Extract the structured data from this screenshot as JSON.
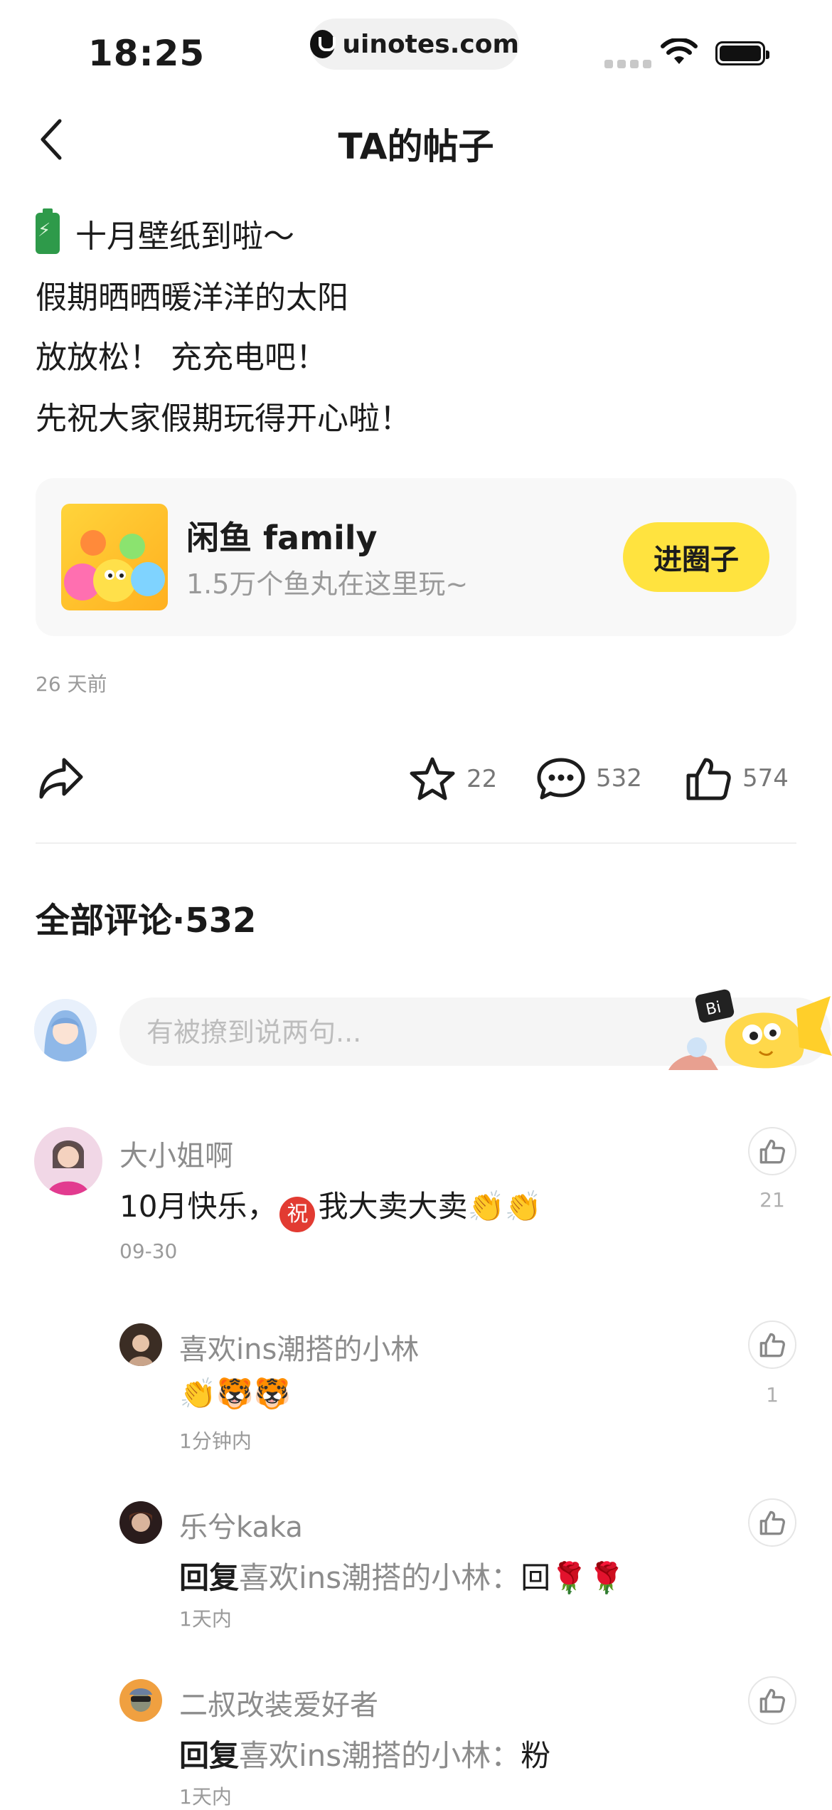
{
  "status_bar": {
    "time": "18:25",
    "url": "uinotes.com"
  },
  "header": {
    "title": "TA的帖子"
  },
  "post": {
    "lines": [
      "十月壁纸到啦～",
      "假期晒晒暖洋洋的太阳",
      "放放松！ 充充电吧！",
      "先祝大家假期玩得开心啦！"
    ],
    "circle": {
      "name": "闲鱼 family",
      "desc": "1.5万个鱼丸在这里玩~",
      "join_label": "进圈子"
    },
    "time": "26 天前",
    "stats": {
      "favorites": "22",
      "comments": "532",
      "likes": "574"
    }
  },
  "comments_section": {
    "title": "全部评论·532",
    "input_placeholder": "有被撩到说两句..."
  },
  "comments": [
    {
      "user": "大小姐啊",
      "text_before": "10月快乐，",
      "badge": "祝",
      "text_after": "我大卖大卖👏👏",
      "date": "09-30",
      "likes": "21"
    },
    {
      "user": "喜欢ins潮搭的小林",
      "text": "👏🐯🐯",
      "date": "1分钟内",
      "likes": "1"
    },
    {
      "user": "乐兮kaka",
      "reply_kw": "回复",
      "reply_to": "喜欢ins潮搭的小林：",
      "text": "回🌹🌹",
      "date": "1天内",
      "likes": ""
    },
    {
      "user": "二叔改装爱好者",
      "reply_kw": "回复",
      "reply_to": "喜欢ins潮搭的小林：",
      "text": "粉",
      "date": "1天内",
      "likes": ""
    }
  ],
  "colors": {
    "accent_yellow": "#ffe33f",
    "muted_text": "#8c8c8c"
  }
}
